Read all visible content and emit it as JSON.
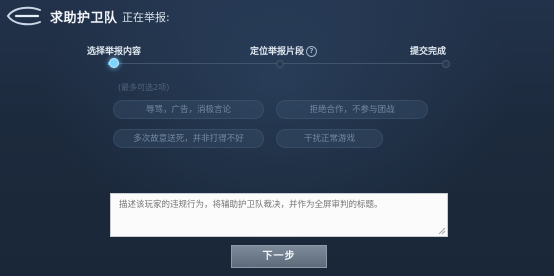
{
  "header": {
    "title": "求助护卫队",
    "subtitle": "正在举报:"
  },
  "steps": [
    {
      "label": "选择举报内容",
      "active": true
    },
    {
      "label": "定位举报片段",
      "active": false,
      "help_icon": "question-circle-icon"
    },
    {
      "label": "提交完成",
      "active": false
    }
  ],
  "options": {
    "hint": "(最多可选2项)",
    "items": [
      {
        "label": "辱骂，广告，消极言论"
      },
      {
        "label": "拒绝合作，不参与团战"
      },
      {
        "label": "多次故意送死，并非打得不好"
      },
      {
        "label": "干扰正常游戏"
      }
    ]
  },
  "description": {
    "placeholder": "描述该玩家的违规行为，将辅助护卫队裁决，并作为全屏审判的标题。",
    "value": ""
  },
  "next_button": {
    "label": "下一步"
  },
  "colors": {
    "background": "#1e2b3e",
    "active_step": "#7fd3ff",
    "option_text": "#7287a1",
    "button": "#6e7b8a"
  }
}
